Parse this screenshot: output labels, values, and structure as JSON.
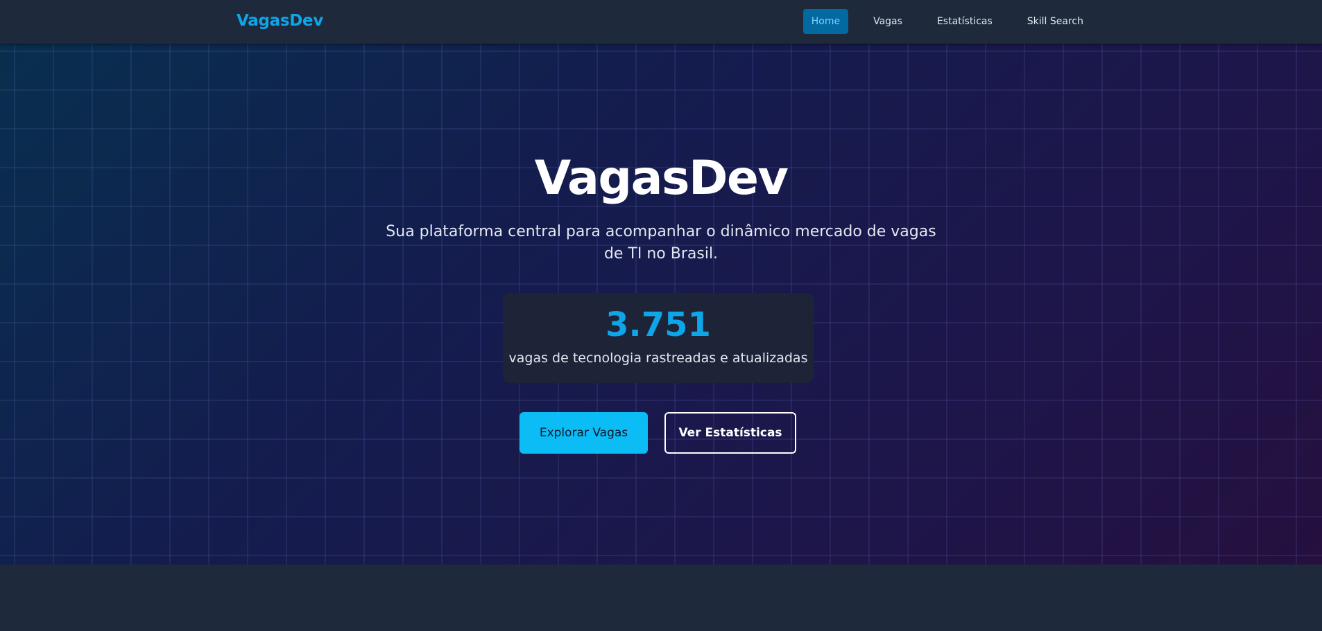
{
  "navbar": {
    "brand": "VagasDev",
    "links": [
      {
        "label": "Home",
        "active": true
      },
      {
        "label": "Vagas",
        "active": false
      },
      {
        "label": "Estatísticas",
        "active": false
      },
      {
        "label": "Skill Search",
        "active": false
      }
    ]
  },
  "hero": {
    "title": "VagasDev",
    "subtitle": "Sua plataforma central para acompanhar o dinâmico mercado de vagas de TI no Brasil.",
    "stats": {
      "count": "3.751",
      "label": "vagas de tecnologia rastreadas e atualizadas"
    },
    "buttons": {
      "primary": "Explorar Vagas",
      "secondary": "Ver Estatísticas"
    }
  },
  "colors": {
    "accent": "#0ea5e9",
    "nav_background": "#1e293b",
    "active_link": "#0369a1"
  }
}
